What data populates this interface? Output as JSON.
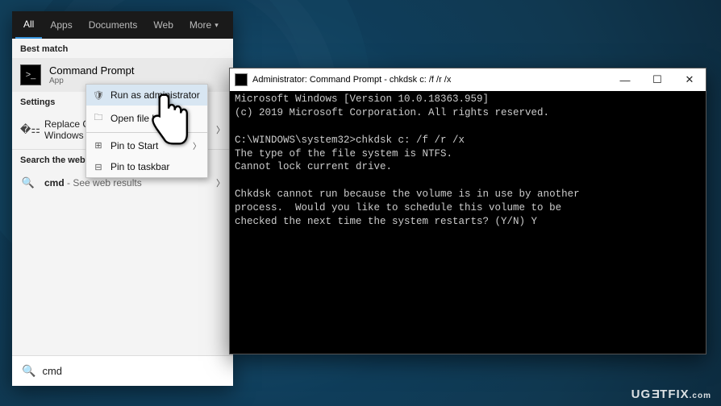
{
  "startmenu": {
    "tabs": {
      "all": "All",
      "apps": "Apps",
      "documents": "Documents",
      "web": "Web",
      "more": "More"
    },
    "best_match_label": "Best match",
    "app": {
      "name": "Command Prompt",
      "type": "App"
    },
    "settings_label": "Settings",
    "settings_item": "Replace Command Prompt with Windows PowerShell",
    "settings_item_visible": "Replace Co\nWindows P",
    "web_label": "Search the web",
    "web_item_prefix": "cmd",
    "web_item_suffix": " - See web results",
    "search_value": "cmd"
  },
  "context_menu": {
    "run_admin": "Run as administrator",
    "open_loc": "Open file location",
    "pin_start": "Pin to Start",
    "pin_taskbar": "Pin to taskbar"
  },
  "cmd": {
    "title": "Administrator: Command Prompt - chkdsk  c: /f /r /x",
    "lines": [
      "Microsoft Windows [Version 10.0.18363.959]",
      "(c) 2019 Microsoft Corporation. All rights reserved.",
      "",
      "C:\\WINDOWS\\system32>chkdsk c: /f /r /x",
      "The type of the file system is NTFS.",
      "Cannot lock current drive.",
      "",
      "Chkdsk cannot run because the volume is in use by another",
      "process.  Would you like to schedule this volume to be",
      "checked the next time the system restarts? (Y/N) Y"
    ]
  },
  "watermark": "UGETFIX"
}
